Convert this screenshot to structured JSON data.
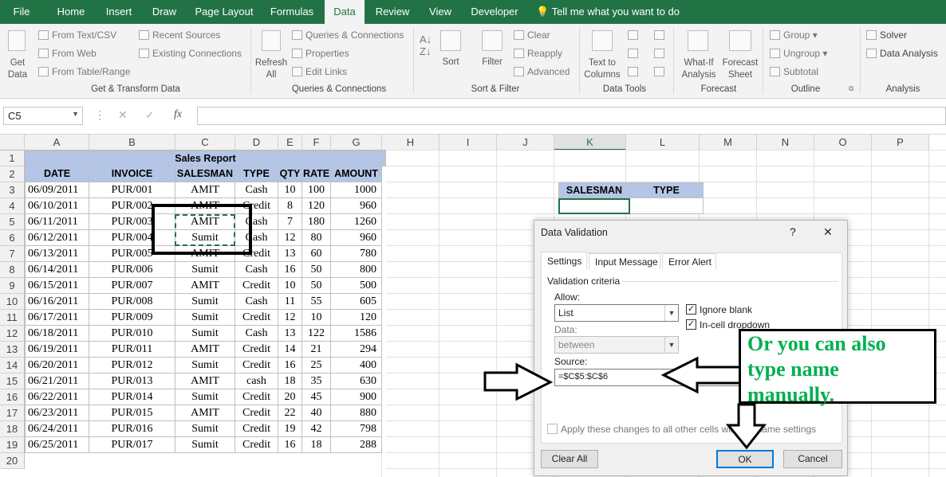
{
  "tabs": [
    "File",
    "Home",
    "Insert",
    "Draw",
    "Page Layout",
    "Formulas",
    "Data",
    "Review",
    "View",
    "Developer"
  ],
  "tell_me": "Tell me what you want to do",
  "ribbon": {
    "get_data": "Get Data",
    "from_text": "From Text/CSV",
    "from_web": "From Web",
    "from_table": "From Table/Range",
    "recent_sources": "Recent Sources",
    "existing_connections": "Existing Connections",
    "group_get": "Get & Transform Data",
    "refresh_all": "Refresh All",
    "queries_connections": "Queries & Connections",
    "properties": "Properties",
    "edit_links": "Edit Links",
    "group_queries": "Queries & Connections",
    "sort": "Sort",
    "filter": "Filter",
    "clear": "Clear",
    "reapply": "Reapply",
    "advanced": "Advanced",
    "group_sort": "Sort & Filter",
    "text_to_columns": "Text to Columns",
    "group_tools": "Data Tools",
    "what_if": "What-If Analysis",
    "forecast_sheet": "Forecast Sheet",
    "group_forecast": "Forecast",
    "group": "Group",
    "ungroup": "Ungroup",
    "subtotal": "Subtotal",
    "group_outline": "Outline",
    "solver": "Solver",
    "data_analysis": "Data Analysis",
    "group_analysis": "Analysis"
  },
  "formula_bar": {
    "name_box": "C5",
    "formula": ""
  },
  "columns": [
    "A",
    "B",
    "C",
    "D",
    "E",
    "F",
    "G",
    "H",
    "I",
    "J",
    "K",
    "L",
    "M",
    "N",
    "O",
    "P"
  ],
  "rows": [
    "1",
    "2",
    "3",
    "4",
    "5",
    "6",
    "7",
    "8",
    "9",
    "10",
    "11",
    "12",
    "13",
    "14",
    "15",
    "16",
    "17",
    "18",
    "19",
    "20"
  ],
  "table": {
    "title": "Sales Report",
    "headers": [
      "DATE",
      "INVOICE",
      "SALESMAN",
      "TYPE",
      "QTY",
      "RATE",
      "AMOUNT"
    ],
    "rows": [
      [
        "06/09/2011",
        "PUR/001",
        "AMIT",
        "Cash",
        "10",
        "100",
        "1000"
      ],
      [
        "06/10/2011",
        "PUR/002",
        "AMIT",
        "Credit",
        "8",
        "120",
        "960"
      ],
      [
        "06/11/2011",
        "PUR/003",
        "AMIT",
        "Cash",
        "7",
        "180",
        "1260"
      ],
      [
        "06/12/2011",
        "PUR/004",
        "Sumit",
        "Cash",
        "12",
        "80",
        "960"
      ],
      [
        "06/13/2011",
        "PUR/005",
        "AMIT",
        "Credit",
        "13",
        "60",
        "780"
      ],
      [
        "06/14/2011",
        "PUR/006",
        "Sumit",
        "Cash",
        "16",
        "50",
        "800"
      ],
      [
        "06/15/2011",
        "PUR/007",
        "AMIT",
        "Credit",
        "10",
        "50",
        "500"
      ],
      [
        "06/16/2011",
        "PUR/008",
        "Sumit",
        "Cash",
        "11",
        "55",
        "605"
      ],
      [
        "06/17/2011",
        "PUR/009",
        "Sumit",
        "Credit",
        "12",
        "10",
        "120"
      ],
      [
        "06/18/2011",
        "PUR/010",
        "Sumit",
        "Cash",
        "13",
        "122",
        "1586"
      ],
      [
        "06/19/2011",
        "PUR/011",
        "AMIT",
        "Credit",
        "14",
        "21",
        "294"
      ],
      [
        "06/20/2011",
        "PUR/012",
        "Sumit",
        "Credit",
        "16",
        "25",
        "400"
      ],
      [
        "06/21/2011",
        "PUR/013",
        "AMIT",
        "cash",
        "18",
        "35",
        "630"
      ],
      [
        "06/22/2011",
        "PUR/014",
        "Sumit",
        "Credit",
        "20",
        "45",
        "900"
      ],
      [
        "06/23/2011",
        "PUR/015",
        "AMIT",
        "Credit",
        "22",
        "40",
        "880"
      ],
      [
        "06/24/2011",
        "PUR/016",
        "Sumit",
        "Credit",
        "19",
        "42",
        "798"
      ],
      [
        "06/25/2011",
        "PUR/017",
        "Sumit",
        "Credit",
        "16",
        "18",
        "288"
      ]
    ]
  },
  "lookup": {
    "headers": [
      "SALESMAN",
      "TYPE"
    ]
  },
  "dialog": {
    "title": "Data Validation",
    "help": "?",
    "close": "✕",
    "tabs": [
      "Settings",
      "Input Message",
      "Error Alert"
    ],
    "criteria": "Validation criteria",
    "allow_label": "Allow:",
    "allow_value": "List",
    "data_label": "Data:",
    "data_value": "between",
    "ignore_blank": "Ignore blank",
    "in_cell_dropdown": "In-cell dropdown",
    "source_label": "Source:",
    "source_value": "=$C$5:$C$6",
    "apply_all": "Apply these changes to all other cells with the same settings",
    "clear_all": "Clear All",
    "ok": "OK",
    "cancel": "Cancel"
  },
  "annotation": {
    "note": "Or you can also type name manually."
  },
  "colors": {
    "ribbon_green": "#217346",
    "header_fill": "#b4c6e7",
    "note_text": "#00b050"
  }
}
